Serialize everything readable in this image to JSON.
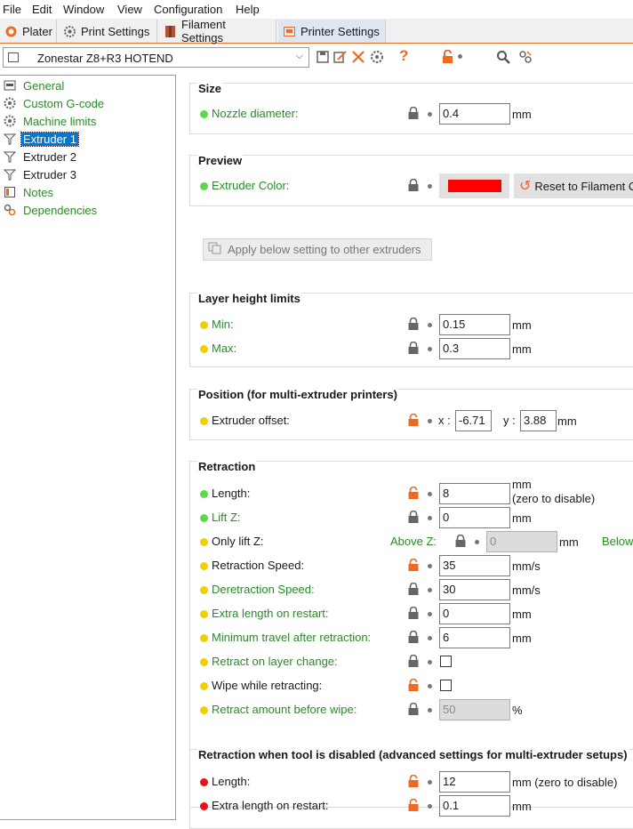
{
  "menu": [
    "File",
    "Edit",
    "Window",
    "View",
    "Configuration",
    "Help"
  ],
  "tabs": [
    "Plater",
    "Print Settings",
    "Filament Settings",
    "Printer Settings"
  ],
  "preset": {
    "name": "Zonestar Z8+R3 HOTEND",
    "chevron": "⌵"
  },
  "sidebar": [
    {
      "label": "General",
      "icon": "printer-icon"
    },
    {
      "label": "Custom G-code",
      "icon": "gear-icon"
    },
    {
      "label": "Machine limits",
      "icon": "gear-icon"
    },
    {
      "label": "Extruder 1",
      "icon": "funnel-icon"
    },
    {
      "label": "Extruder 2",
      "icon": "funnel-icon"
    },
    {
      "label": "Extruder 3",
      "icon": "funnel-icon"
    },
    {
      "label": "Notes",
      "icon": "notes-icon"
    },
    {
      "label": "Dependencies",
      "icon": "link-icon"
    }
  ],
  "size": {
    "title": "Size",
    "nozzle_label": "Nozzle diameter:",
    "nozzle_value": "0.4",
    "unit": "mm"
  },
  "preview": {
    "title": "Preview",
    "color_label": "Extruder Color:",
    "color": "#ff0000",
    "reset_label": "Reset to Filament C"
  },
  "apply_label": "Apply below setting to other extruders",
  "layer": {
    "title": "Layer height limits",
    "min_label": "Min:",
    "min_value": "0.15",
    "max_label": "Max:",
    "max_value": "0.3",
    "unit": "mm"
  },
  "position": {
    "title": "Position (for multi-extruder printers)",
    "offset_label": "Extruder offset:",
    "x_label": "x :",
    "x_value": "-6.71",
    "y_label": "y :",
    "y_value": "3.88",
    "unit": "mm"
  },
  "retraction": {
    "title": "Retraction",
    "length_label": "Length:",
    "length_value": "8",
    "length_unit": "mm",
    "length_note": "(zero to disable)",
    "liftz_label": "Lift Z:",
    "liftz_value": "0",
    "liftz_unit": "mm",
    "onlylift_label": "Only lift Z:",
    "above_label": "Above Z:",
    "above_value": "0",
    "above_unit": "mm",
    "below_label": "Below",
    "speed_label": "Retraction Speed:",
    "speed_value": "35",
    "speed_unit": "mm/s",
    "deretract_label": "Deretraction Speed:",
    "deretract_value": "30",
    "deretract_unit": "mm/s",
    "extra_label": "Extra length on restart:",
    "extra_value": "0",
    "extra_unit": "mm",
    "mintravel_label": "Minimum travel after retraction:",
    "mintravel_value": "6",
    "mintravel_unit": "mm",
    "layerchange_label": "Retract on layer change:",
    "wipe_label": "Wipe while retracting:",
    "beforewipe_label": "Retract amount before wipe:",
    "beforewipe_value": "50",
    "beforewipe_unit": "%"
  },
  "toolchange": {
    "title": "Retraction when tool is disabled (advanced settings for multi-extruder setups)",
    "length_label": "Length:",
    "length_value": "12",
    "length_unit": "mm (zero to disable)",
    "extra_label": "Extra length on restart:",
    "extra_value": "0.1",
    "extra_unit": "mm"
  },
  "colors": {
    "accent": "#ed6b21",
    "green_label": "#2a8a2a",
    "selection": "#0078d7"
  }
}
